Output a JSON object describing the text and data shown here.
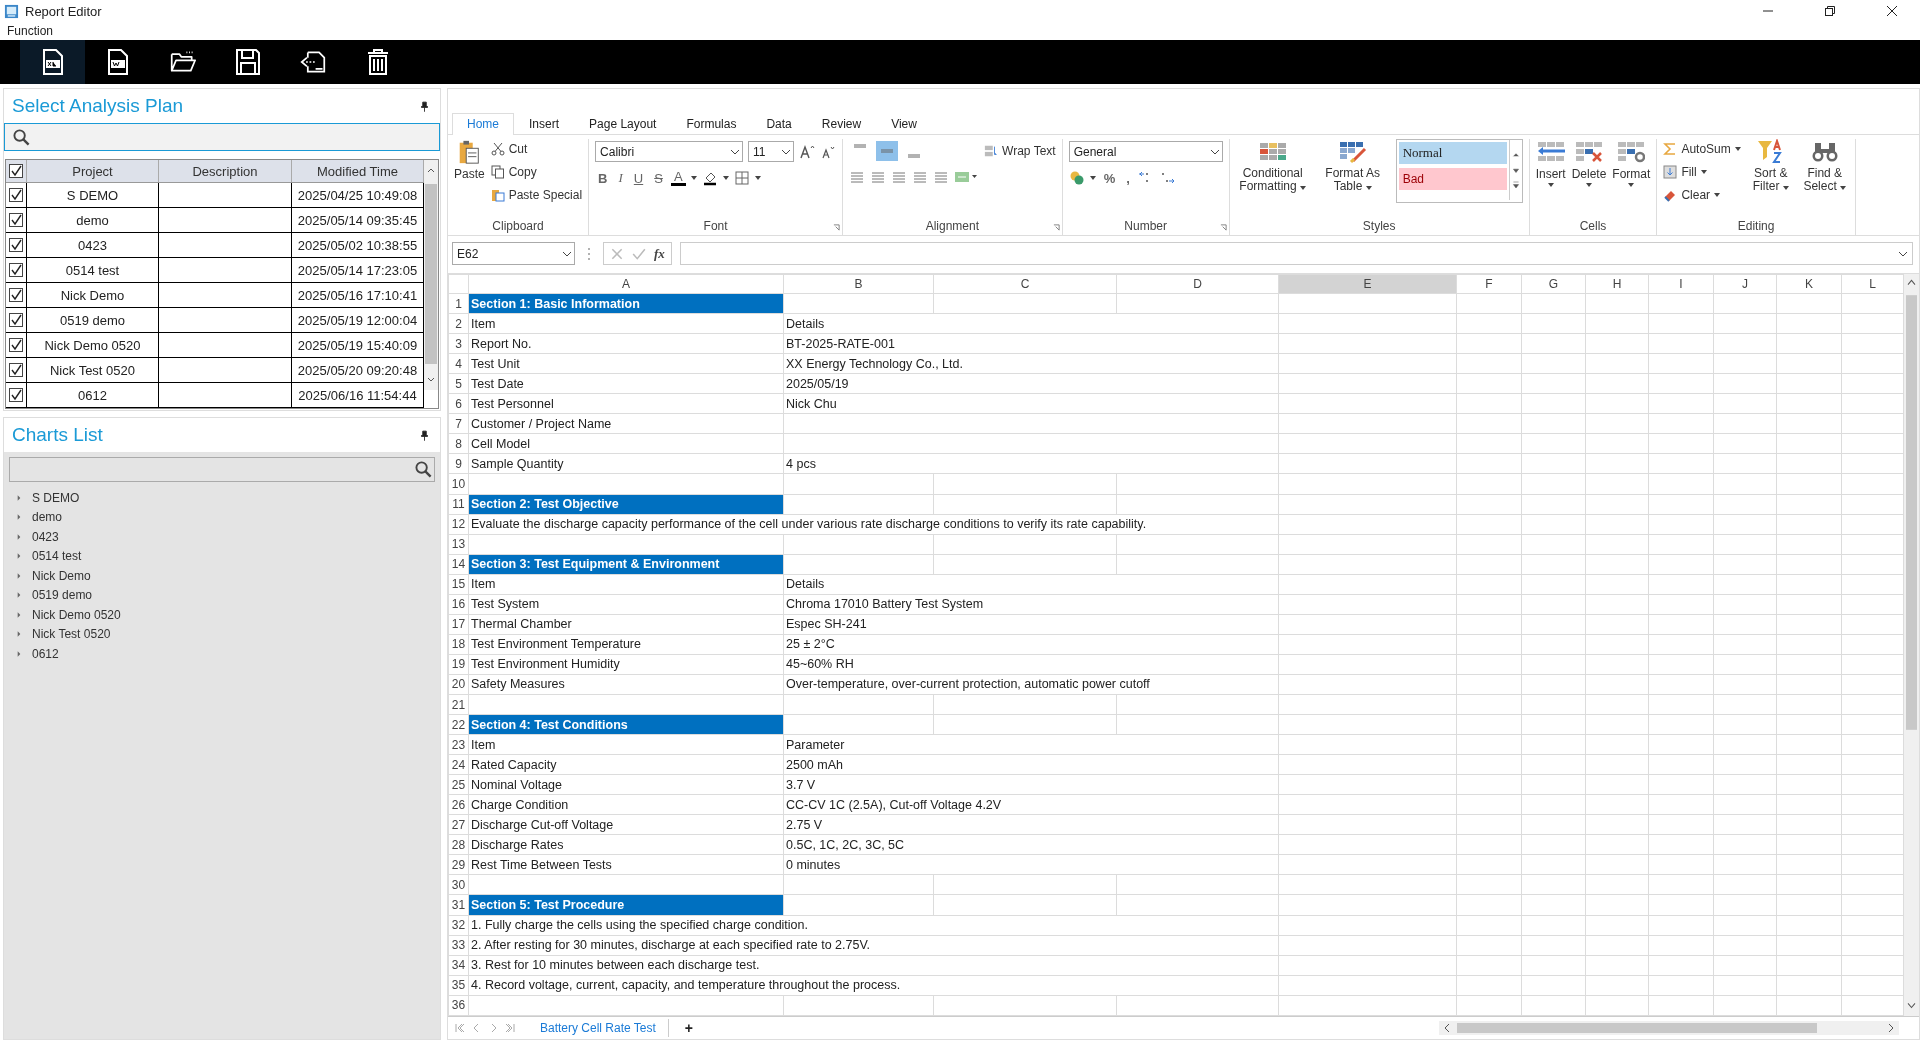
{
  "window": {
    "title": "Report Editor"
  },
  "menu": [
    "Function"
  ],
  "toolbar": [
    {
      "kind": "excel",
      "selected": true
    },
    {
      "kind": "word",
      "selected": false
    },
    {
      "kind": "open",
      "selected": false
    },
    {
      "kind": "save",
      "selected": false
    },
    {
      "kind": "export",
      "selected": false
    },
    {
      "kind": "delete",
      "selected": false
    }
  ],
  "plans": {
    "title": "Select Analysis Plan",
    "header_checked": true,
    "columns": [
      "Project",
      "Description",
      "Modified Time"
    ],
    "rows": [
      {
        "project": "S DEMO",
        "time": "2025/04/25 10:49:08",
        "checked": true
      },
      {
        "project": "demo",
        "time": "2025/05/14 09:35:45",
        "checked": true
      },
      {
        "project": "0423",
        "time": "2025/05/02 10:38:55",
        "checked": true
      },
      {
        "project": "0514 test",
        "time": "2025/05/14 17:23:05",
        "checked": true
      },
      {
        "project": "Nick Demo",
        "time": "2025/05/16 17:10:41",
        "checked": true
      },
      {
        "project": "0519 demo",
        "time": "2025/05/19 12:00:04",
        "checked": true
      },
      {
        "project": "Nick Demo 0520",
        "time": "2025/05/19 15:40:09",
        "checked": true
      },
      {
        "project": "Nick Test 0520",
        "time": "2025/05/20 09:20:48",
        "checked": true
      },
      {
        "project": "0612",
        "time": "2025/06/16 11:54:44",
        "checked": true
      }
    ]
  },
  "charts": {
    "title": "Charts List",
    "items": [
      "S DEMO",
      "demo",
      "0423",
      "0514 test",
      "Nick Demo",
      "0519 demo",
      "Nick Demo 0520",
      "Nick Test 0520",
      "0612"
    ]
  },
  "ribbon": {
    "tabs": [
      {
        "label": "Home",
        "selected": true
      },
      {
        "label": "Insert",
        "selected": false
      },
      {
        "label": "Page Layout",
        "selected": false
      },
      {
        "label": "Formulas",
        "selected": false
      },
      {
        "label": "Data",
        "selected": false
      },
      {
        "label": "Review",
        "selected": false
      },
      {
        "label": "View",
        "selected": false
      }
    ],
    "clipboard": {
      "label": "Clipboard",
      "paste": "Paste",
      "cut": "Cut",
      "copy": "Copy",
      "paste_special": "Paste Special"
    },
    "font": {
      "label": "Font",
      "name": "Calibri",
      "size": "11",
      "bold": "B",
      "italic": "I",
      "underline": "U",
      "strike": "S",
      "color_letter": "A"
    },
    "alignment": {
      "label": "Alignment",
      "vertical": [
        {
          "selected": false
        },
        {
          "selected": true
        },
        {
          "selected": false
        }
      ],
      "wrap_text": "Wrap Text"
    },
    "number": {
      "label": "Number",
      "format": "General",
      "percent": "%",
      "comma": ","
    },
    "styles": {
      "label": "Styles",
      "conditional": "Conditional Formatting",
      "as_table": "Format As Table",
      "normal": "Normal",
      "bad": "Bad"
    },
    "cells": {
      "label": "Cells",
      "insert": "Insert",
      "delete": "Delete",
      "format": "Format"
    },
    "editing": {
      "label": "Editing",
      "autosum": "AutoSum",
      "fill": "Fill",
      "clear": "Clear",
      "sort": "Sort & Filter",
      "find": "Find & Select"
    }
  },
  "formula_bar": {
    "name_box": "E62",
    "fx": "fx"
  },
  "sheet": {
    "columns": [
      {
        "label": "A",
        "selected": false
      },
      {
        "label": "B",
        "selected": false
      },
      {
        "label": "C",
        "selected": false
      },
      {
        "label": "D",
        "selected": false
      },
      {
        "label": "E",
        "selected": true
      },
      {
        "label": "F",
        "selected": false
      },
      {
        "label": "G",
        "selected": false
      },
      {
        "label": "H",
        "selected": false
      },
      {
        "label": "I",
        "selected": false
      },
      {
        "label": "J",
        "selected": false
      },
      {
        "label": "K",
        "selected": false
      },
      {
        "label": "L",
        "selected": false
      }
    ],
    "rows": [
      {
        "n": "1",
        "kind": "section",
        "a": "Section 1: Basic Information"
      },
      {
        "n": "2",
        "kind": "field",
        "a": "Item",
        "b": "Details"
      },
      {
        "n": "3",
        "kind": "field",
        "a": "Report No.",
        "b": "BT-2025-RATE-001"
      },
      {
        "n": "4",
        "kind": "field",
        "a": "Test Unit",
        "b": "XX Energy Technology Co., Ltd."
      },
      {
        "n": "5",
        "kind": "field",
        "a": "Test Date",
        "b": "2025/05/19"
      },
      {
        "n": "6",
        "kind": "field",
        "a": "Test Personnel",
        "b": "Nick Chu"
      },
      {
        "n": "7",
        "kind": "field",
        "a": "Customer / Project Name"
      },
      {
        "n": "8",
        "kind": "field",
        "a": "Cell Model"
      },
      {
        "n": "9",
        "kind": "field",
        "a": "Sample Quantity",
        "b": "4 pcs"
      },
      {
        "n": "10",
        "kind": "blank"
      },
      {
        "n": "11",
        "kind": "section",
        "a": "Section 2: Test Objective"
      },
      {
        "n": "12",
        "kind": "note",
        "a": "Evaluate the discharge capacity performance of the cell under various rate discharge conditions to verify its rate capability."
      },
      {
        "n": "13",
        "kind": "blank"
      },
      {
        "n": "14",
        "kind": "section",
        "a": "Section 3: Test Equipment & Environment"
      },
      {
        "n": "15",
        "kind": "field",
        "a": "Item",
        "b": "Details"
      },
      {
        "n": "16",
        "kind": "field",
        "a": "Test System",
        "b": "Chroma 17010 Battery Test System"
      },
      {
        "n": "17",
        "kind": "field",
        "a": "Thermal Chamber",
        "b": "Espec SH-241"
      },
      {
        "n": "18",
        "kind": "field",
        "a": "Test Environment Temperature",
        "b": "25 ± 2°C"
      },
      {
        "n": "19",
        "kind": "field",
        "a": "Test Environment Humidity",
        "b": "45~60% RH"
      },
      {
        "n": "20",
        "kind": "field",
        "a": "Safety Measures",
        "b": "Over-temperature, over-current protection, automatic power cutoff"
      },
      {
        "n": "21",
        "kind": "blank"
      },
      {
        "n": "22",
        "kind": "section",
        "a": "Section 4: Test Conditions"
      },
      {
        "n": "23",
        "kind": "field",
        "a": "Item",
        "b": "Parameter"
      },
      {
        "n": "24",
        "kind": "field",
        "a": "Rated Capacity",
        "b": "2500 mAh"
      },
      {
        "n": "25",
        "kind": "field",
        "a": "Nominal Voltage",
        "b": "3.7 V"
      },
      {
        "n": "26",
        "kind": "field",
        "a": "Charge Condition",
        "b": "CC-CV 1C (2.5A), Cut-off Voltage 4.2V"
      },
      {
        "n": "27",
        "kind": "field",
        "a": "Discharge Cut-off Voltage",
        "b": "2.75 V"
      },
      {
        "n": "28",
        "kind": "field",
        "a": "Discharge Rates",
        "b": "0.5C, 1C, 2C, 3C, 5C"
      },
      {
        "n": "29",
        "kind": "field",
        "a": "Rest Time Between Tests",
        "b": "0 minutes"
      },
      {
        "n": "30",
        "kind": "blank"
      },
      {
        "n": "31",
        "kind": "section",
        "a": "Section 5: Test Procedure"
      },
      {
        "n": "32",
        "kind": "note",
        "a": "1. Fully charge the cells using the specified charge condition."
      },
      {
        "n": "33",
        "kind": "note",
        "a": "2. After resting for 30 minutes, discharge at each specified rate to 2.75V."
      },
      {
        "n": "34",
        "kind": "note",
        "a": "3. Rest for 10 minutes between each discharge test."
      },
      {
        "n": "35",
        "kind": "note",
        "a": "4. Record voltage, current, capacity, and temperature throughout the process."
      },
      {
        "n": "36",
        "kind": "blank"
      }
    ],
    "tabs": [
      {
        "label": "Battery Cell Rate Test",
        "selected": true
      }
    ],
    "add_tab": "+"
  }
}
